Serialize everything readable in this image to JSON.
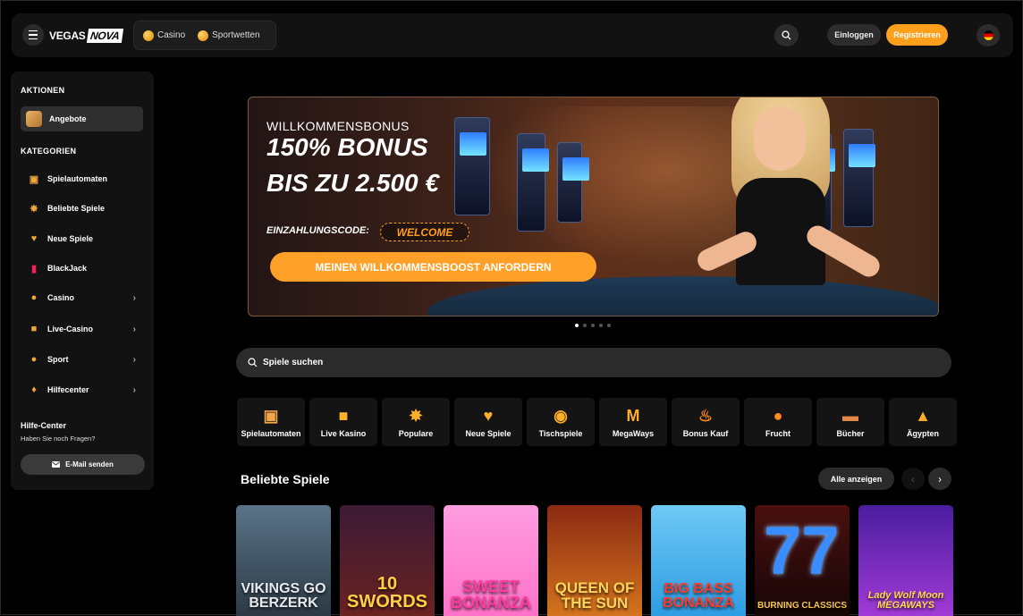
{
  "header": {
    "logo_left": "VEGAS",
    "logo_right": "NOVA",
    "tabs": [
      {
        "label": "Casino"
      },
      {
        "label": "Sportwetten"
      }
    ],
    "login_label": "Einloggen",
    "register_label": "Registrieren"
  },
  "sidebar": {
    "actions_title": "AKTIONEN",
    "offers_label": "Angebote",
    "categories_title": "KATEGORIEN",
    "categories": [
      {
        "label": "Spielautomaten",
        "icon": "slot-icon"
      },
      {
        "label": "Beliebte Spiele",
        "icon": "star-icon"
      },
      {
        "label": "Neue Spiele",
        "icon": "heart-icon"
      },
      {
        "label": "BlackJack",
        "icon": "cards-icon"
      },
      {
        "label": "Casino",
        "icon": "casino-chip-icon"
      },
      {
        "label": "Live-Casino",
        "icon": "live-icon"
      },
      {
        "label": "Sport",
        "icon": "ball-icon"
      },
      {
        "label": "Hilfecenter",
        "icon": "bulb-icon"
      }
    ],
    "help_title": "Hilfe-Center",
    "help_subtitle": "Haben Sie noch Fragen?",
    "email_button": "E-Mail senden"
  },
  "banner": {
    "pretitle": "WILLKOMMENSBONUS",
    "headline_1": "150% BONUS",
    "headline_2": "BIS ZU 2.500 €",
    "code_label": "EINZAHLUNGSCODE:",
    "code_value": "WELCOME",
    "cta_label": "MEINEN WILLKOMMENSBOOST ANFORDERN",
    "slide_count": 5,
    "active_slide": 1
  },
  "search": {
    "placeholder": "Spiele suchen"
  },
  "game_categories": [
    {
      "label": "Spielautomaten",
      "icon": "slot-icon"
    },
    {
      "label": "Live Kasino",
      "icon": "live-icon"
    },
    {
      "label": "Populare",
      "icon": "star-icon"
    },
    {
      "label": "Neue Spiele",
      "icon": "heart-icon"
    },
    {
      "label": "Tischspiele",
      "icon": "chip-icon"
    },
    {
      "label": "MegaWays",
      "icon": "megaways-icon"
    },
    {
      "label": "Bonus Kauf",
      "icon": "fire-icon"
    },
    {
      "label": "Frucht",
      "icon": "fruit-icon"
    },
    {
      "label": "Bücher",
      "icon": "book-icon"
    },
    {
      "label": "Ägypten",
      "icon": "pyramid-icon"
    }
  ],
  "popular": {
    "title": "Beliebte Spiele",
    "show_all_label": "Alle anzeigen",
    "games": [
      {
        "title": "VIKINGS GO BERZERK"
      },
      {
        "title": "10 SWORDS"
      },
      {
        "title": "SWEET BONANZA"
      },
      {
        "title": "QUEEN OF THE SUN"
      },
      {
        "title": "BIG BASS BONANZA"
      },
      {
        "title": "BURNING CLASSICS"
      },
      {
        "title": "Lady Wolf Moon MEGAWAYS"
      }
    ]
  },
  "colors": {
    "accent": "#ff9f1c",
    "background": "#000000",
    "panel": "#121212"
  }
}
